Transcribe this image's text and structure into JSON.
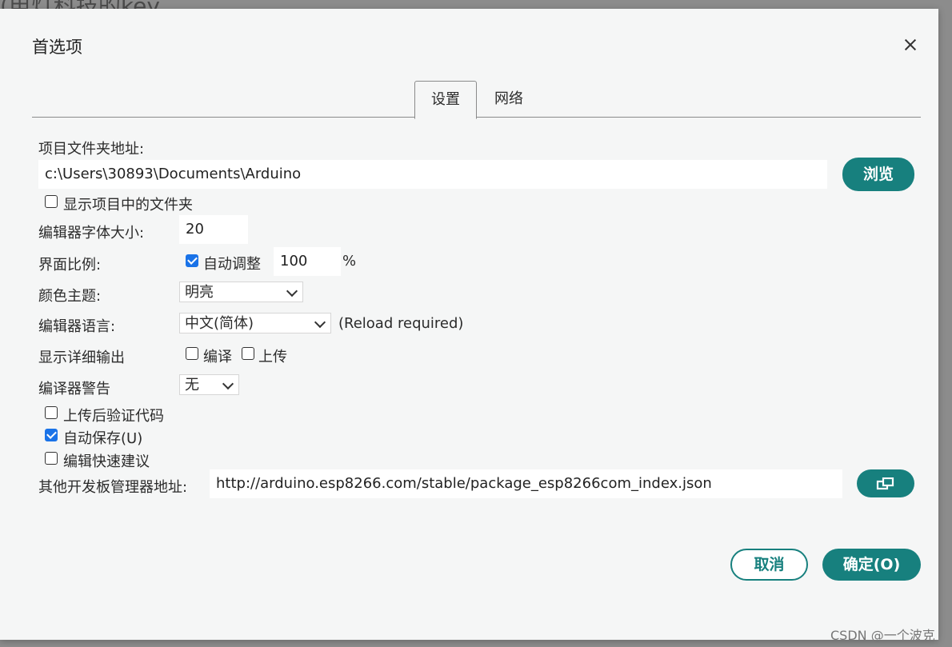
{
  "background": {
    "text": "(电灯科技的key"
  },
  "dialog": {
    "title": "首选项",
    "tabs": [
      {
        "label": "设置"
      },
      {
        "label": "网络"
      }
    ],
    "sketchbook": {
      "label": "项目文件夹地址:",
      "value": "c:\\Users\\30893\\Documents\\Arduino",
      "browse_label": "浏览"
    },
    "show_files_in_project": {
      "label": "显示项目中的文件夹",
      "checked": false
    },
    "editor_font_size": {
      "label": "编辑器字体大小:",
      "value": "20"
    },
    "interface_scale": {
      "label": "界面比例:",
      "auto_label": "自动调整",
      "auto_checked": true,
      "value": "100",
      "unit": "%"
    },
    "theme": {
      "label": "颜色主题:",
      "selected": "明亮"
    },
    "language": {
      "label": "编辑器语言:",
      "selected": "中文(简体)",
      "note": "(Reload required)"
    },
    "verbose_output": {
      "label": "显示详细输出",
      "compile_label": "编译",
      "compile_checked": false,
      "upload_label": "上传",
      "upload_checked": false
    },
    "compiler_warnings": {
      "label": "编译器警告",
      "selected": "无"
    },
    "verify_after_upload": {
      "label": "上传后验证代码",
      "checked": false
    },
    "auto_save": {
      "label": "自动保存(U)",
      "checked": true
    },
    "quick_suggestions": {
      "label": "编辑快速建议",
      "checked": false
    },
    "board_manager_urls": {
      "label": "其他开发板管理器地址:",
      "value": "http://arduino.esp8266.com/stable/package_esp8266com_index.json"
    },
    "cancel_label": "取消",
    "ok_label": "确定(O)"
  },
  "watermark": "CSDN @一个波克",
  "colors": {
    "accent": "#17807e",
    "checkbox": "#1a73e8",
    "dialog_bg": "#f5f6f6"
  }
}
